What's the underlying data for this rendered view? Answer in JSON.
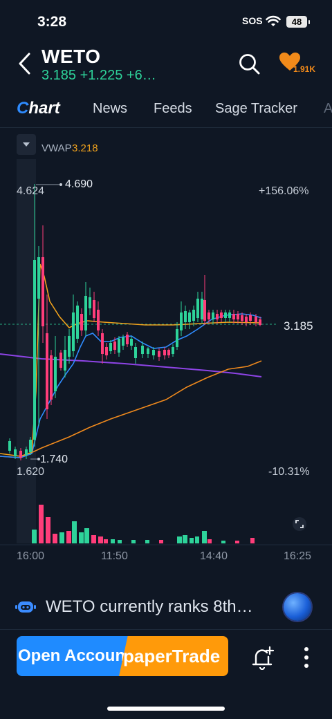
{
  "status_bar": {
    "time": "3:28",
    "carrier": "SOS",
    "battery": "48"
  },
  "header": {
    "ticker": "WETO",
    "quote": "3.185 +1.225 +6…",
    "watch_count": "1.91K"
  },
  "tabs": [
    {
      "label": "Chart",
      "active": true
    },
    {
      "label": "News"
    },
    {
      "label": "Feeds"
    },
    {
      "label": "Sage Tracker"
    },
    {
      "label": "A"
    }
  ],
  "chart": {
    "indicator_name": "VWAP",
    "indicator_value": "3.218",
    "high_price": "4.624",
    "high_marker": "4.690",
    "low_price": "1.620",
    "low_marker": "1.740",
    "current_price": "3.185",
    "pct_top": "+156.06%",
    "pct_bottom": "-10.31%",
    "time_labels": [
      "16:00",
      "11:50",
      "14:40",
      "16:25"
    ],
    "colors": {
      "up": "#2ed39a",
      "down": "#ff3d7a",
      "vwap": "#f0a21d",
      "ma_blue": "#2f8cff",
      "ma_purple": "#8e44e6",
      "ma_orange": "#f08a1d"
    }
  },
  "info_bar": {
    "message": "WETO currently ranks 8th…"
  },
  "toolbar": {
    "open_account": "Open Account",
    "paper_trade": "paperTrade"
  }
}
